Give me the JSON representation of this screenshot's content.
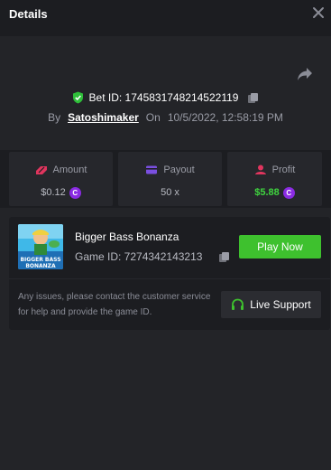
{
  "header": {
    "title": "Details"
  },
  "bet": {
    "id_text": "Bet ID: 1745831748214522119",
    "by_label": "By",
    "username": "Satoshimaker",
    "on_label": "On",
    "datetime": "10/5/2022, 12:58:19 PM"
  },
  "stats": {
    "amount": {
      "label": "Amount",
      "value": "$0.12"
    },
    "payout": {
      "label": "Payout",
      "value": "50 x"
    },
    "profit": {
      "label": "Profit",
      "value": "$5.88"
    }
  },
  "game": {
    "thumb_text_1": "BIGGER BASS",
    "thumb_text_2": "BONANZA",
    "name": "Bigger Bass Bonanza",
    "id_text": "Game ID: 7274342143213",
    "play_label": "Play Now"
  },
  "support": {
    "message": "Any issues, please contact the customer service for help and provide the game ID.",
    "button_label": "Live Support"
  },
  "colors": {
    "accent_green": "#3ec12e",
    "profit_green": "#3fd43f",
    "coin_purple": "#8a2be2",
    "shield_green": "#2fbf3a"
  }
}
